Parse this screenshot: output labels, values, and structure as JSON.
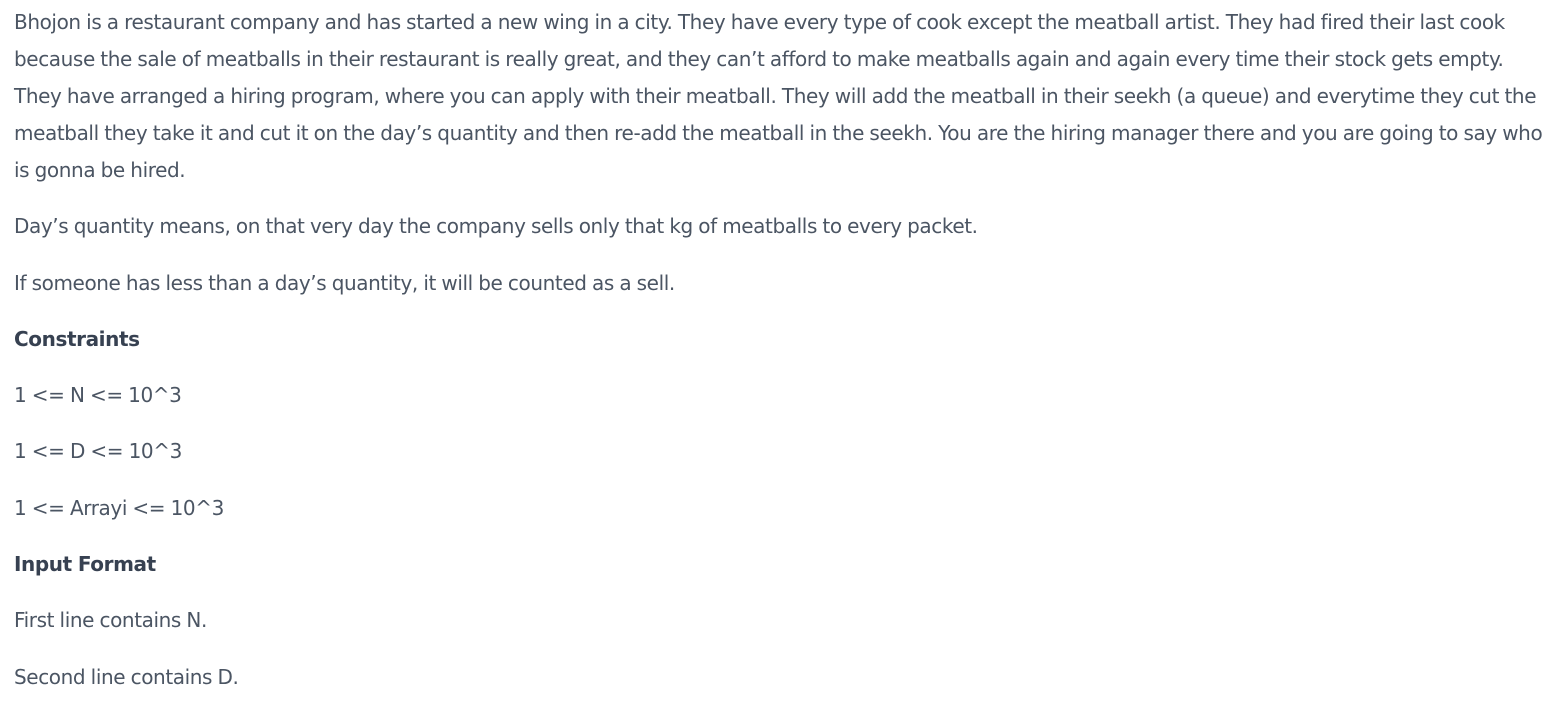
{
  "problem": {
    "intro": "Bhojon is a restaurant company and has started a new wing in a city. They have every type of cook except the meatball artist. They had fired their last cook because the sale of meatballs in their restaurant is really great, and they can’t afford to make meatballs again and again every time their stock gets empty. They have arranged a hiring program, where you can apply with their meatball. They will add the meatball in their seekh (a queue) and everytime they cut the meatball they take it and cut it on the day’s quantity and then re-add the meatball in the seekh. You are the hiring manager there and you are going to say who is gonna be hired.",
    "quantity_definition": "Day’s quantity means, on that very day the company sells only that kg of meatballs to every packet.",
    "sell_rule": "If someone has less than a day’s quantity, it will be counted as a sell."
  },
  "constraints": {
    "heading": "Constraints",
    "items": [
      "1 <= N <= 10^3",
      "1 <= D <= 10^3",
      "1 <= Arrayi <= 10^3"
    ]
  },
  "input_format": {
    "heading": "Input Format",
    "lines": [
      "First line contains N.",
      "Second line contains D."
    ]
  }
}
